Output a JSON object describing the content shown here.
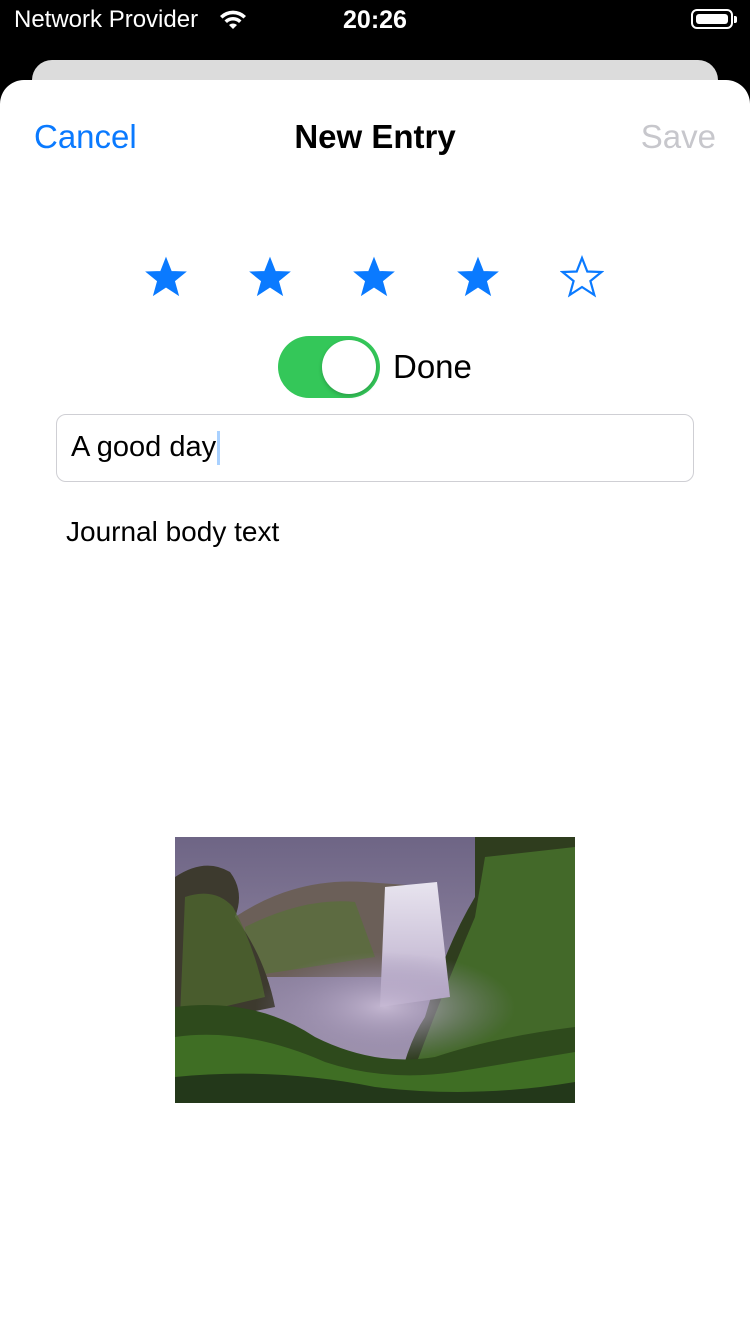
{
  "status": {
    "carrier": "Network Provider",
    "time": "20:26"
  },
  "nav": {
    "cancel_label": "Cancel",
    "title": "New Entry",
    "save_label": "Save",
    "save_enabled": false
  },
  "rating": {
    "value": 4,
    "max": 5,
    "color": "#0a7aff"
  },
  "done_toggle": {
    "label": "Done",
    "on": true,
    "color": "#34c759"
  },
  "title_field": {
    "value": "A good day"
  },
  "body": {
    "text": "Journal body text"
  },
  "photo": {
    "icon": "waterfall-photo"
  }
}
